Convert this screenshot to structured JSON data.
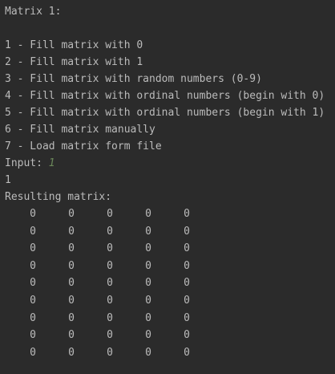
{
  "console": {
    "header": "Matrix 1:",
    "menu": [
      "1 - Fill matrix with 0",
      "2 - Fill matrix with 1",
      "3 - Fill matrix with random numbers (0-9)",
      "4 - Fill matrix with ordinal numbers (begin with 0)",
      "5 - Fill matrix with ordinal numbers (begin with 1)",
      "6 - Fill matrix manually",
      "7 - Load matrix form file"
    ],
    "input_prompt": "Input: ",
    "input_value": "1",
    "echo": "1",
    "result_label": "Resulting matrix:",
    "matrix": [
      [
        "0",
        "0",
        "0",
        "0",
        "0"
      ],
      [
        "0",
        "0",
        "0",
        "0",
        "0"
      ],
      [
        "0",
        "0",
        "0",
        "0",
        "0"
      ],
      [
        "0",
        "0",
        "0",
        "0",
        "0"
      ],
      [
        "0",
        "0",
        "0",
        "0",
        "0"
      ],
      [
        "0",
        "0",
        "0",
        "0",
        "0"
      ],
      [
        "0",
        "0",
        "0",
        "0",
        "0"
      ],
      [
        "0",
        "0",
        "0",
        "0",
        "0"
      ],
      [
        "0",
        "0",
        "0",
        "0",
        "0"
      ]
    ]
  },
  "colors": {
    "background": "#2b2b2b",
    "text": "#bbbbbb",
    "user_input": "#6a8759"
  }
}
